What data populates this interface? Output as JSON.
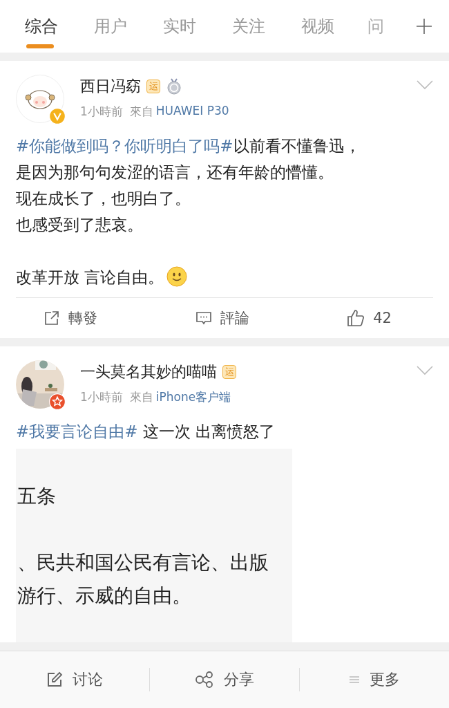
{
  "tabs": [
    {
      "label": "综合",
      "selected": true
    },
    {
      "label": "用户",
      "selected": false
    },
    {
      "label": "实时",
      "selected": false
    },
    {
      "label": "关注",
      "selected": false
    },
    {
      "label": "视频",
      "selected": false
    },
    {
      "label": "问",
      "selected": false,
      "faded": true
    }
  ],
  "posts": [
    {
      "author": "西日冯窈",
      "avatar": {
        "kind": "icon"
      },
      "verified": {
        "kind": "check",
        "color": "#f5b21c"
      },
      "badges": [
        {
          "kind": "text",
          "text": "运"
        },
        {
          "kind": "medal"
        }
      ],
      "time": "1小時前",
      "source_prefix": "來自",
      "source": "HUAWEI P30",
      "body": [
        [
          [
            {
              "kind": "hashtag",
              "text": "#你能做到吗？你听明白了吗#"
            },
            {
              "kind": "text",
              "text": "以前看不懂鲁迅，"
            }
          ],
          [
            {
              "kind": "text",
              "text": "是因为那句句发涩的语言，还有年龄的懵懂。"
            }
          ],
          [
            {
              "kind": "text",
              "text": "现在成长了，也明白了。"
            }
          ],
          [
            {
              "kind": "text",
              "text": "也感受到了悲哀。"
            }
          ]
        ],
        [
          [
            {
              "kind": "text",
              "text": "改革开放 言论自由。"
            },
            {
              "kind": "emoji"
            }
          ]
        ]
      ],
      "actions": [
        {
          "kind": "repost",
          "label": "轉發"
        },
        {
          "kind": "comment",
          "label": "評論"
        },
        {
          "kind": "like",
          "label": "42"
        }
      ]
    },
    {
      "author": "一头莫名其妙的喵喵",
      "avatar": {
        "kind": "picture"
      },
      "verified": {
        "kind": "star",
        "color": "#e9502c"
      },
      "badges": [
        {
          "kind": "text",
          "text": "运"
        }
      ],
      "time": "1小時前",
      "source_prefix": "來自",
      "source": "iPhone客户端",
      "body": [
        [
          [
            {
              "kind": "hashtag",
              "text": "#我要言论自由#"
            },
            {
              "kind": "text",
              "text": " 这一次 出离愤怒了"
            }
          ]
        ]
      ],
      "image_lines": [
        {
          "kind": "heading",
          "text": "五条"
        },
        {
          "kind": "line",
          "text": "、民共和国公民有言论、出版"
        },
        {
          "kind": "line",
          "text": "游行、示威的自由。"
        }
      ]
    }
  ],
  "bottom_bar": [
    {
      "kind": "discuss",
      "label": "讨论"
    },
    {
      "kind": "share",
      "label": "分享"
    },
    {
      "kind": "more",
      "label": "更多"
    }
  ]
}
